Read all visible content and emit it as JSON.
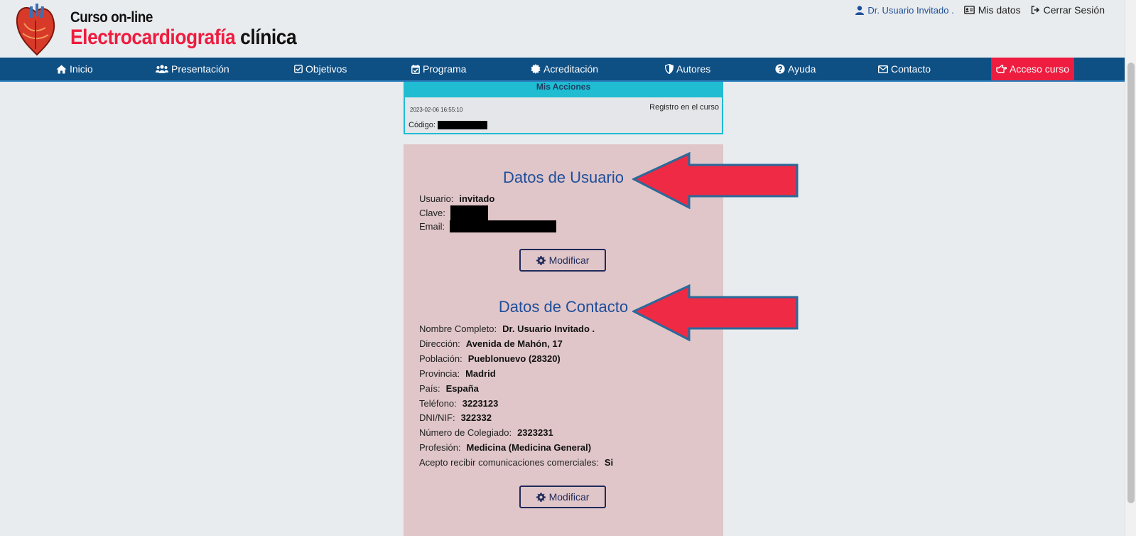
{
  "header": {
    "title_line1": "Curso on-line",
    "title_red": "Electrocardiografía",
    "title_black": "clínica",
    "logo_icon": "heart-anatomy-icon"
  },
  "userbar": {
    "user": "Dr. Usuario Invitado .",
    "mis_datos": "Mis datos",
    "cerrar": "Cerrar Sesión"
  },
  "nav": {
    "items": [
      {
        "label": "Inicio",
        "icon": "home-icon"
      },
      {
        "label": "Presentación",
        "icon": "users-icon"
      },
      {
        "label": "Objetivos",
        "icon": "check-square-icon"
      },
      {
        "label": "Programa",
        "icon": "calendar-check-icon"
      },
      {
        "label": "Acreditación",
        "icon": "certificate-icon"
      },
      {
        "label": "Autores",
        "icon": "shield-icon"
      },
      {
        "label": "Ayuda",
        "icon": "question-circle-icon"
      },
      {
        "label": "Contacto",
        "icon": "envelope-icon"
      },
      {
        "label": "Acceso curso",
        "icon": "hand-point-right-icon"
      }
    ],
    "accent": "#ee1c3f",
    "bg": "#0e4f84"
  },
  "acciones": {
    "heading": "Mis Acciones",
    "date": "2023-02-06 16:55:10",
    "event": "Registro en el curso",
    "code_label": "Código:"
  },
  "usuario": {
    "title": "Datos de Usuario",
    "usuario_label": "Usuario:",
    "usuario_value": "invitado",
    "clave_label": "Clave:",
    "email_label": "Email:",
    "button": "Modificar"
  },
  "contacto": {
    "title": "Datos de Contacto",
    "fields": [
      {
        "label": "Nombre Completo:",
        "value": "Dr. Usuario Invitado ."
      },
      {
        "label": "Dirección:",
        "value": "Avenida de Mahón, 17"
      },
      {
        "label": "Población:",
        "value": "Pueblonuevo (28320)"
      },
      {
        "label": "Provincia:",
        "value": "Madrid"
      },
      {
        "label": "País:",
        "value": "España"
      },
      {
        "label": "Teléfono:",
        "value": "3223123"
      },
      {
        "label": "DNI/NIF:",
        "value": "322332"
      },
      {
        "label": "Número de Colegiado:",
        "value": "2323231"
      },
      {
        "label": "Profesión:",
        "value": "Medicina (Medicina General)"
      },
      {
        "label": "Acepto recibir comunicaciones comerciales:",
        "value": "Si"
      }
    ],
    "button": "Modificar"
  }
}
